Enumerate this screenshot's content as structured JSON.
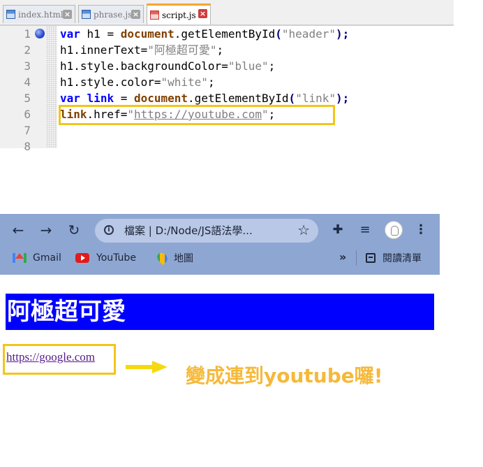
{
  "editor": {
    "tabs": [
      {
        "label": "index.html",
        "active": false
      },
      {
        "label": "phrase.js",
        "active": false
      },
      {
        "label": "script.js",
        "active": true
      }
    ],
    "line_numbers": [
      "1",
      "2",
      "3",
      "4",
      "5",
      "6",
      "7",
      "8"
    ],
    "lines": [
      [
        "var",
        " h1 = ",
        "document",
        ".getElementById",
        "(",
        "\"header\"",
        ");"
      ],
      [
        "h1.innerText=",
        "\"阿極超可愛\"",
        ";"
      ],
      [
        "h1.style.backgroundColor=",
        "\"blue\"",
        ";"
      ],
      [
        "h1.style.color=",
        "\"white\"",
        ";"
      ],
      [
        "var",
        " ",
        "link",
        " = ",
        "document",
        ".getElementById",
        "(",
        "\"link\"",
        ");"
      ],
      [
        "link",
        ".href=",
        "\"",
        "https://youtube.com",
        "\"",
        ";"
      ]
    ]
  },
  "browser": {
    "url_prefix": "檔案",
    "url": "D:/Node/JS語法學...",
    "bookmarks": [
      "Gmail",
      "YouTube",
      "地圖"
    ],
    "overflow": "»",
    "reading_list": "閱讀清單",
    "icons": [
      "back-arrow",
      "forward-arrow",
      "reload",
      "info",
      "star",
      "extensions-puzzle",
      "media-controls",
      "profile-avatar",
      "kebab-menu"
    ]
  },
  "page": {
    "header_text": "阿極超可愛",
    "link_text": "https://google.com"
  },
  "annotation": {
    "text": "變成連到youtube囉!",
    "color": "#f5b93a"
  },
  "colors": {
    "highlight_box": "#f2c51b",
    "header_bg": "#0000ff",
    "browser_chrome": "#8ea7d2"
  }
}
